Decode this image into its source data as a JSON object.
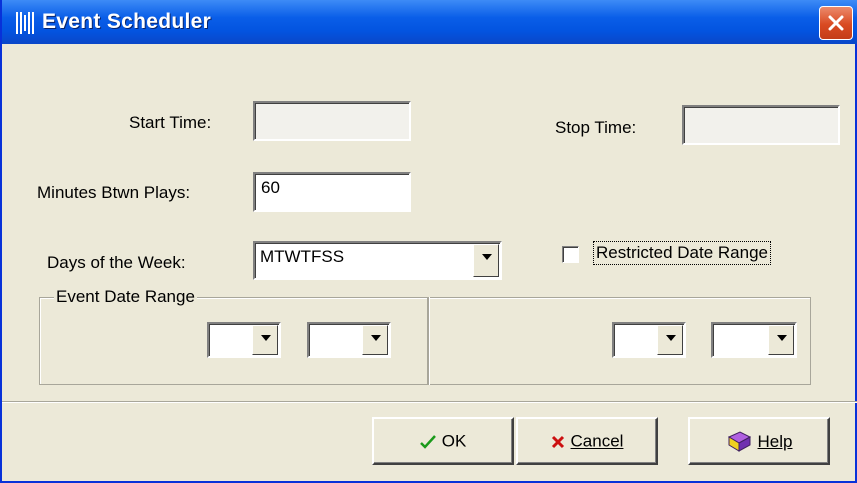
{
  "window": {
    "title": "Event Scheduler"
  },
  "fields": {
    "start_time": {
      "label": "Start Time:",
      "value": ""
    },
    "stop_time": {
      "label": "Stop Time:",
      "value": ""
    },
    "minutes_btwn_plays": {
      "label": "Minutes Btwn Plays:",
      "value": "60"
    },
    "days_of_week": {
      "label": "Days of the Week:",
      "value": "MTWTFSS"
    },
    "restricted_date_range": {
      "label": "Restricted Date Range",
      "checked": false
    }
  },
  "event_date_range": {
    "title": "Event Date Range",
    "start_month": "",
    "start_day": "",
    "end_month": "",
    "end_day": ""
  },
  "buttons": {
    "ok": {
      "label": "OK",
      "icon": "checkmark-icon"
    },
    "cancel": {
      "label": "Cancel",
      "icon": "x-icon"
    },
    "help": {
      "label": "Help",
      "icon": "help-book-icon"
    }
  },
  "colors": {
    "titlebar": "#0a5ee8",
    "dialog_bg": "#ece9d8",
    "close": "#d94a22"
  }
}
